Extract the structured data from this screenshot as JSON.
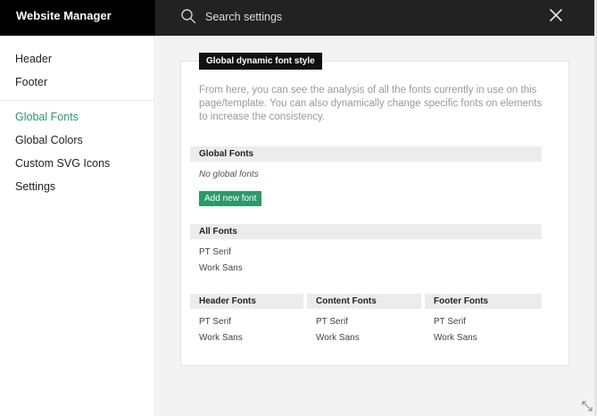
{
  "app": {
    "title": "Website Manager"
  },
  "search": {
    "placeholder": "Search settings"
  },
  "sidebar": {
    "group1": [
      {
        "label": "Header"
      },
      {
        "label": "Footer"
      }
    ],
    "group2": [
      {
        "label": "Global Fonts",
        "active": true
      },
      {
        "label": "Global Colors"
      },
      {
        "label": "Custom SVG Icons"
      },
      {
        "label": "Settings"
      }
    ]
  },
  "panel": {
    "tag": "Global dynamic font style",
    "description": "From here, you can see the analysis of all the fonts currently in use on this page/template. You can also dynamically change specific fonts on elements to increase the consistency.",
    "global_fonts": {
      "title": "Global Fonts",
      "empty_text": "No global fonts",
      "add_button": "Add new font"
    },
    "all_fonts": {
      "title": "All Fonts",
      "items": [
        "PT Serif",
        "Work Sans"
      ]
    },
    "header_fonts": {
      "title": "Header Fonts",
      "items": [
        "PT Serif",
        "Work Sans"
      ]
    },
    "content_fonts": {
      "title": "Content Fonts",
      "items": [
        "PT Serif",
        "Work Sans"
      ]
    },
    "footer_fonts": {
      "title": "Footer Fonts",
      "items": [
        "PT Serif",
        "Work Sans"
      ]
    }
  },
  "colors": {
    "accent": "#2a9a6a",
    "topbar": "#222222",
    "brand_bar": "#000000"
  }
}
